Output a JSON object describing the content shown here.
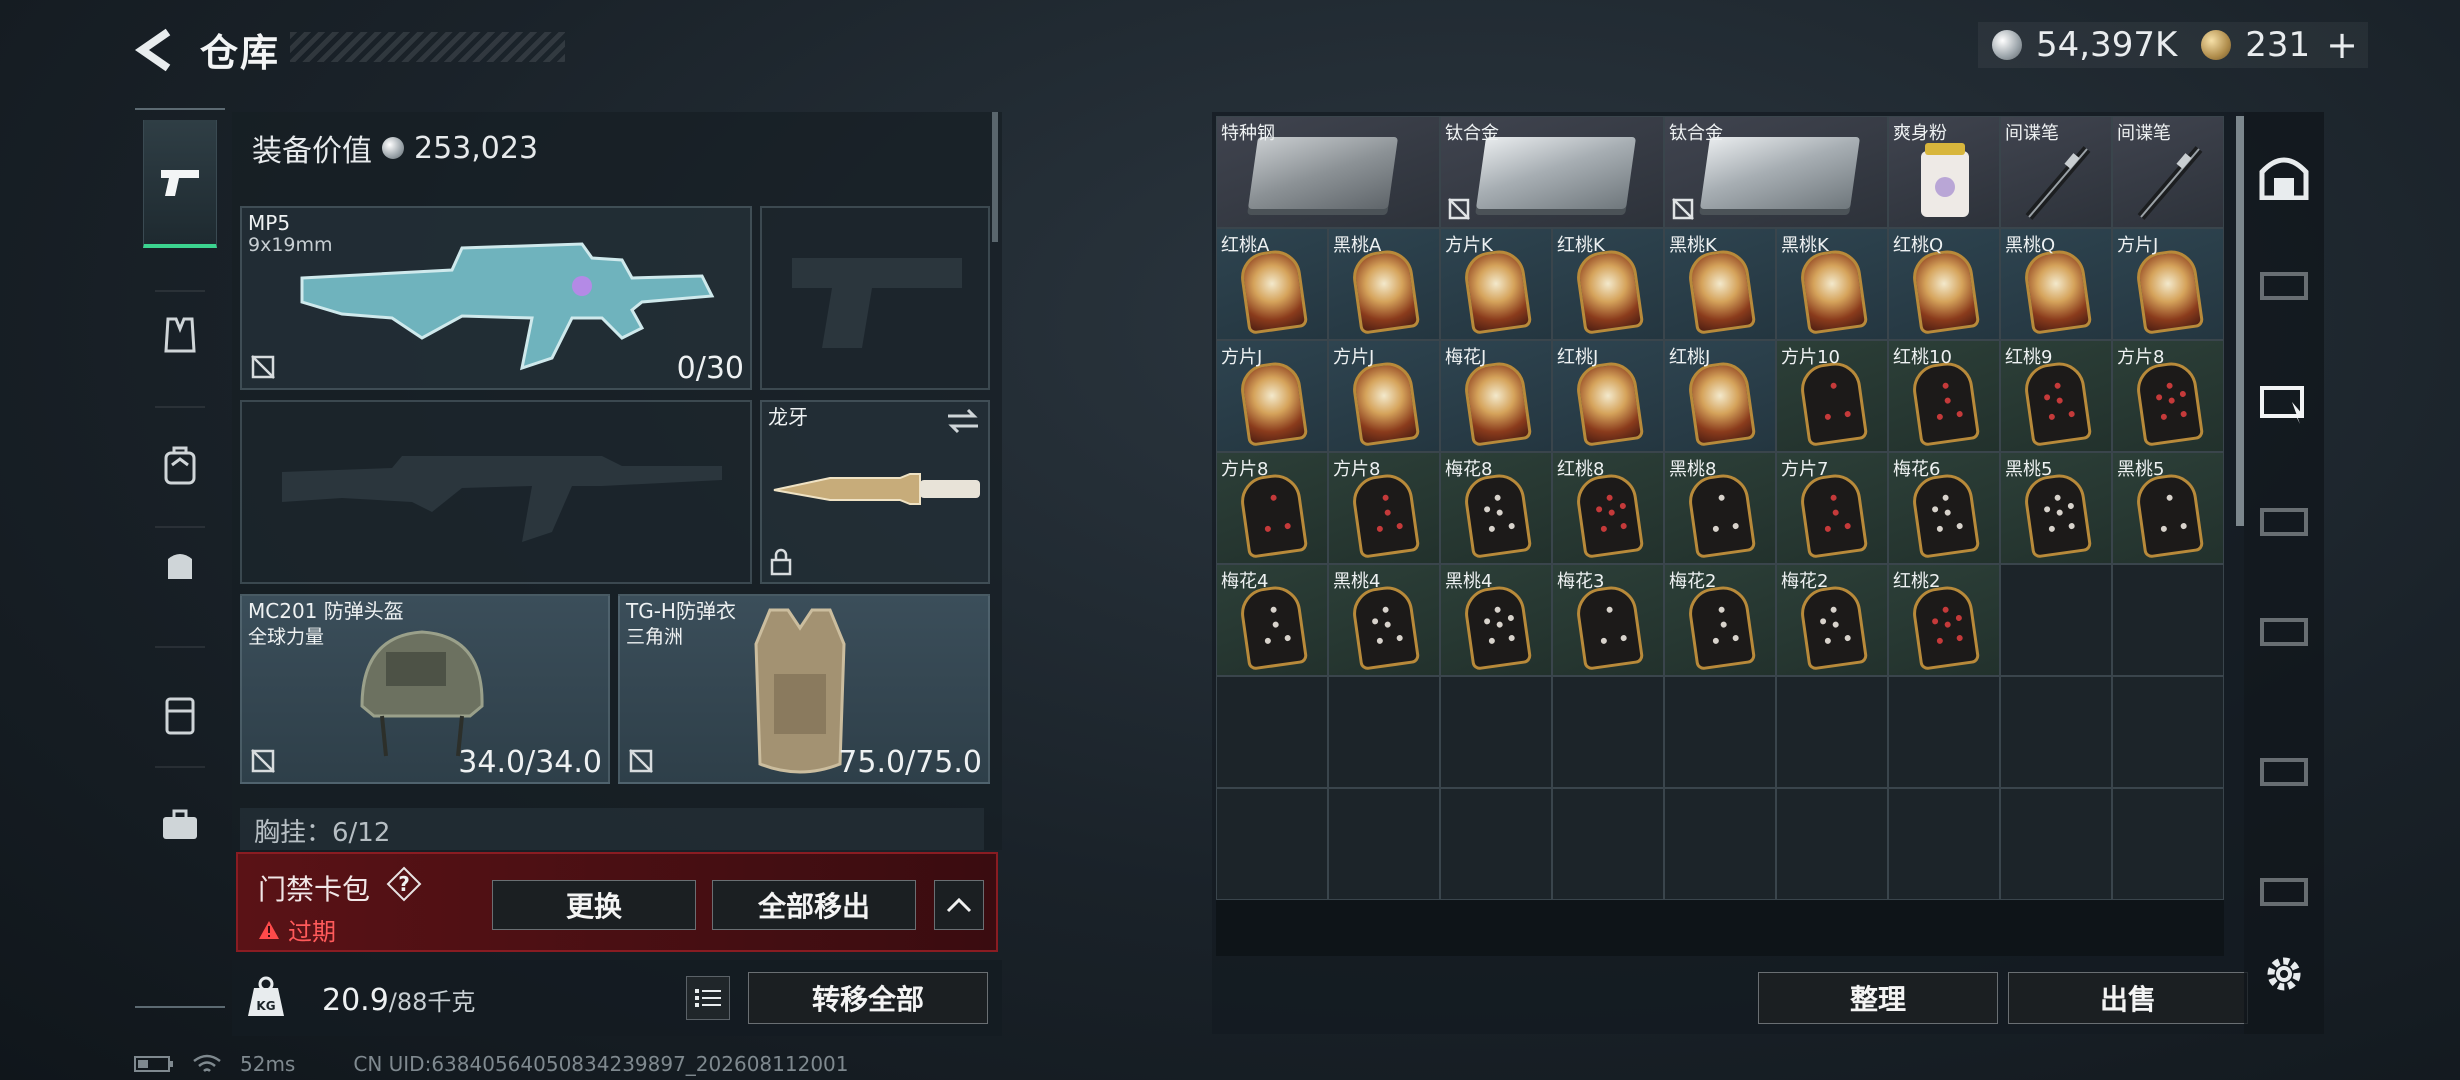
{
  "header": {
    "title": "仓库"
  },
  "currency": {
    "silver": "54,397K",
    "gold": "231",
    "plus": "+"
  },
  "equip": {
    "value_label": "装备价值",
    "value": "253,023",
    "weapon1": {
      "name": "MP5",
      "caliber": "9x19mm",
      "ammo": "0/30"
    },
    "melee": {
      "name": "龙牙"
    },
    "helmet": {
      "name": "MC201 防弹头盔",
      "source": "全球力量",
      "durability": "34.0/34.0"
    },
    "armor": {
      "name": "TG-H防弹衣",
      "source": "三角洲",
      "durability": "75.0/75.0"
    },
    "chest": "胸挂：6/12"
  },
  "access_card": {
    "title": "门禁卡包",
    "help": "?",
    "status": "过期",
    "replace_btn": "更换",
    "remove_all_btn": "全部移出"
  },
  "weight": {
    "current": "20.9",
    "max": "/88千克",
    "transfer_all_btn": "转移全部"
  },
  "status_bar": {
    "ping": "52ms",
    "uid": "CN UID:63840564050834239897_202608112001"
  },
  "storage": {
    "sort_btn": "整理",
    "sell_btn": "出售",
    "items": [
      {
        "label": "特种钢",
        "kind": "steel",
        "span": 2
      },
      {
        "label": "钛合金",
        "kind": "ingot",
        "span": 2
      },
      {
        "label": "钛合金",
        "kind": "ingot",
        "span": 2
      },
      {
        "label": "爽身粉",
        "kind": "powder",
        "span": 1
      },
      {
        "label": "间谍笔",
        "kind": "pen",
        "span": 1
      },
      {
        "label": "间谍笔",
        "kind": "pen",
        "span": 1
      },
      {
        "label": "红桃A",
        "kind": "face"
      },
      {
        "label": "黑桃A",
        "kind": "face"
      },
      {
        "label": "方片K",
        "kind": "face"
      },
      {
        "label": "红桃K",
        "kind": "face"
      },
      {
        "label": "黑桃K",
        "kind": "face"
      },
      {
        "label": "黑桃K",
        "kind": "face"
      },
      {
        "label": "红桃Q",
        "kind": "face"
      },
      {
        "label": "黑桃Q",
        "kind": "face"
      },
      {
        "label": "方片J",
        "kind": "face"
      },
      {
        "label": "方片J",
        "kind": "face"
      },
      {
        "label": "方片J",
        "kind": "face"
      },
      {
        "label": "梅花J",
        "kind": "face"
      },
      {
        "label": "红桃J",
        "kind": "face"
      },
      {
        "label": "红桃J",
        "kind": "face"
      },
      {
        "label": "方片10",
        "kind": "num"
      },
      {
        "label": "红桃10",
        "kind": "num"
      },
      {
        "label": "红桃9",
        "kind": "num"
      },
      {
        "label": "方片8",
        "kind": "num"
      },
      {
        "label": "方片8",
        "kind": "num"
      },
      {
        "label": "方片8",
        "kind": "num"
      },
      {
        "label": "梅花8",
        "kind": "num"
      },
      {
        "label": "红桃8",
        "kind": "num"
      },
      {
        "label": "黑桃8",
        "kind": "num"
      },
      {
        "label": "方片7",
        "kind": "num"
      },
      {
        "label": "梅花6",
        "kind": "num"
      },
      {
        "label": "黑桃5",
        "kind": "num"
      },
      {
        "label": "黑桃5",
        "kind": "num"
      },
      {
        "label": "梅花4",
        "kind": "num"
      },
      {
        "label": "黑桃4",
        "kind": "num"
      },
      {
        "label": "黑桃4",
        "kind": "num"
      },
      {
        "label": "梅花3",
        "kind": "num"
      },
      {
        "label": "梅花2",
        "kind": "num"
      },
      {
        "label": "梅花2",
        "kind": "num"
      },
      {
        "label": "红桃2",
        "kind": "num"
      }
    ]
  }
}
